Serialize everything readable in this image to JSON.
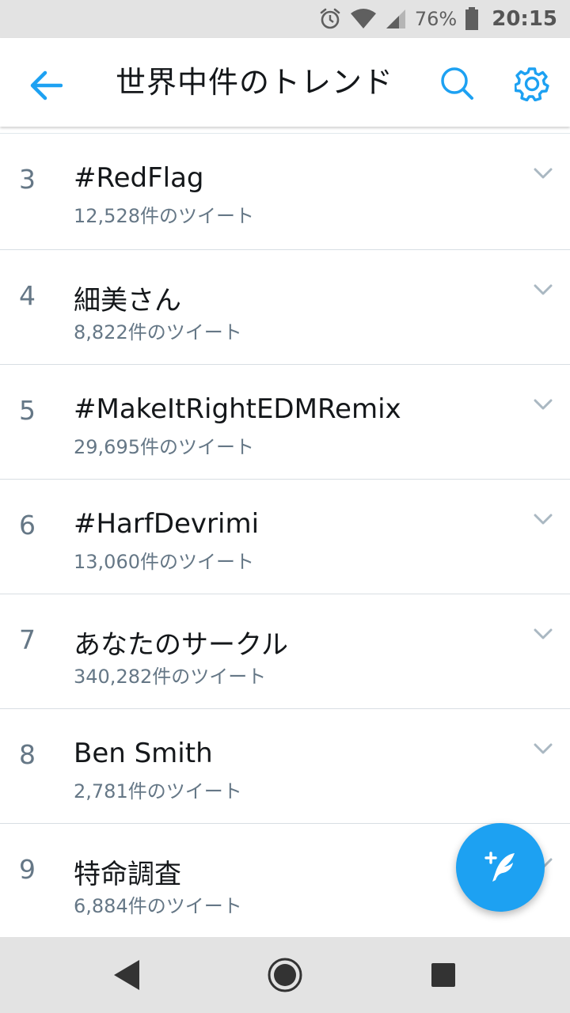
{
  "status_bar": {
    "battery_percent": "76%",
    "time": "20:15",
    "icons": [
      "alarm-icon",
      "wifi-icon",
      "cell-signal-icon",
      "battery-icon"
    ]
  },
  "app_bar": {
    "title": "世界中件のトレンド",
    "back_icon": "arrow-left-icon",
    "search_icon": "search-icon",
    "settings_icon": "gear-icon",
    "accent_color": "#1da1f2"
  },
  "trends": [
    {
      "rank": "3",
      "name": "#RedFlag",
      "count": "12,528件のツイート"
    },
    {
      "rank": "4",
      "name": "細美さん",
      "count": "8,822件のツイート"
    },
    {
      "rank": "5",
      "name": "#MakeItRightEDMRemix",
      "count": "29,695件のツイート"
    },
    {
      "rank": "6",
      "name": "#HarfDevrimi",
      "count": "13,060件のツイート"
    },
    {
      "rank": "7",
      "name": "あなたのサークル",
      "count": "340,282件のツイート"
    },
    {
      "rank": "8",
      "name": "Ben Smith",
      "count": "2,781件のツイート"
    },
    {
      "rank": "9",
      "name": "特命調査",
      "count": "6,884件のツイート"
    }
  ],
  "fab": {
    "icon": "compose-tweet-icon",
    "color": "#1da1f2"
  },
  "nav_bar": {
    "icons": [
      "back-triangle-icon",
      "home-circle-icon",
      "recents-square-icon"
    ]
  }
}
